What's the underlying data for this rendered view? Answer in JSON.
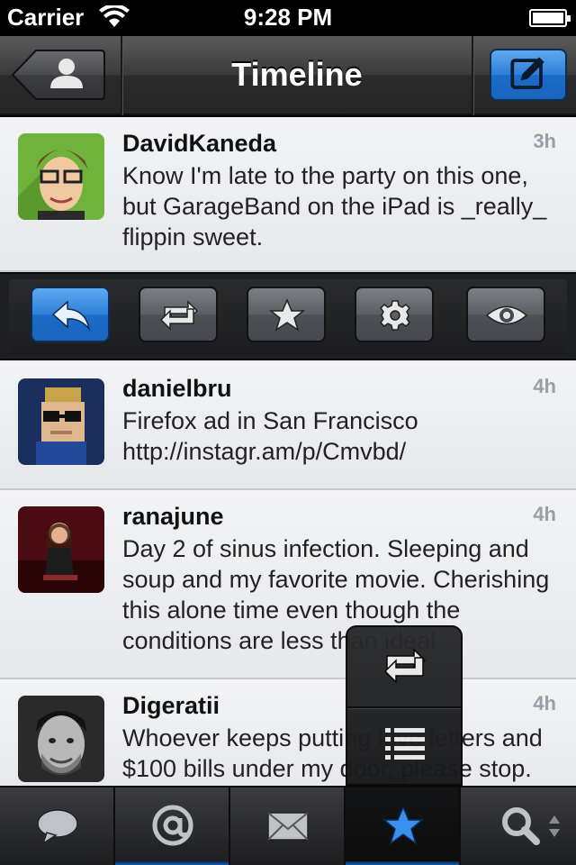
{
  "status_bar": {
    "carrier": "Carrier",
    "time": "9:28 PM"
  },
  "nav": {
    "title": "Timeline"
  },
  "tweets": [
    {
      "user": "DavidKaneda",
      "age": "3h",
      "text": "Know I'm late to the party on this one, but GarageBand on the iPad is _really_ flippin sweet."
    },
    {
      "user": "danielbru",
      "age": "4h",
      "text": "Firefox ad in San Francisco http://instagr.am/p/Cmvbd/"
    },
    {
      "user": "ranajune",
      "age": "4h",
      "text": "Day 2 of sinus infection. Sleeping and soup and my favorite movie. Cherishing this alone time even though the conditions are less than ideal"
    },
    {
      "user": "Digeratii",
      "age": "4h",
      "text": "Whoever keeps putting love letters and $100 bills under my door, please stop."
    }
  ],
  "actions": [
    "reply",
    "retweet",
    "favorite",
    "settings",
    "view"
  ],
  "popup_menu": [
    "retweets",
    "lists"
  ],
  "tabs": [
    "timeline",
    "mentions",
    "messages",
    "favorites",
    "search"
  ],
  "active_tab": "favorites",
  "colors": {
    "accent_blue": "#2d7fd8",
    "bar_dark": "#252525",
    "cell_bg": "#eef0f3"
  }
}
